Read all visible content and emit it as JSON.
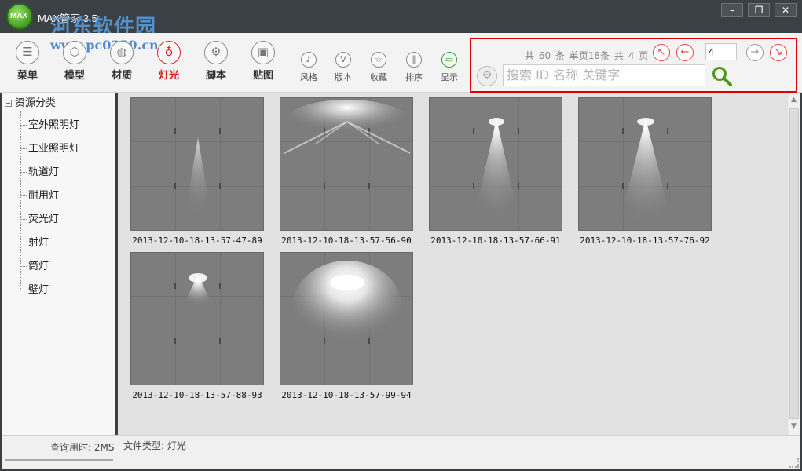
{
  "titlebar": {
    "app_title": "MAX管家 3.5",
    "logo_text": "MAX",
    "watermark": "河东软件园",
    "watermark_url": "www.pc0359.cn",
    "buttons": [
      "minimize",
      "restore",
      "close"
    ]
  },
  "toolbar": {
    "tools": [
      {
        "label": "菜单",
        "icon": "menu-icon"
      },
      {
        "label": "模型",
        "icon": "cube-icon"
      },
      {
        "label": "材质",
        "icon": "material-icon"
      },
      {
        "label": "灯光",
        "icon": "bulb-icon",
        "active": true
      },
      {
        "label": "脚本",
        "icon": "gear-icon"
      },
      {
        "label": "贴图",
        "icon": "image-icon"
      }
    ],
    "small_tools": [
      {
        "label": "风格",
        "icon": "music-note-icon"
      },
      {
        "label": "版本",
        "icon": "version-icon"
      },
      {
        "label": "收藏",
        "icon": "star-icon"
      },
      {
        "label": "排序",
        "icon": "sort-icon"
      },
      {
        "label": "显示",
        "icon": "display-icon"
      }
    ],
    "active_color": "#e02020"
  },
  "pagination": {
    "total_prefix": "共",
    "total": "60",
    "total_unit": "条",
    "per_page_text": "单页18条",
    "pages_prefix": "共",
    "pages": "4",
    "pages_unit": "页",
    "current_page": "4"
  },
  "search": {
    "placeholder": "搜索 ID 名称 关键字"
  },
  "sidebar": {
    "root_toggle": "⊟",
    "root": "资源分类",
    "items": [
      "室外照明灯",
      "工业照明灯",
      "轨道灯",
      "耐用灯",
      "荧光灯",
      "射灯",
      "筒灯",
      "壁灯"
    ]
  },
  "thumbnails": [
    {
      "caption": "2013-12-10-18-13-57-47-89"
    },
    {
      "caption": "2013-12-10-18-13-57-56-90"
    },
    {
      "caption": "2013-12-10-18-13-57-66-91"
    },
    {
      "caption": "2013-12-10-18-13-57-76-92"
    },
    {
      "caption": "2013-12-10-18-13-57-88-93"
    },
    {
      "caption": "2013-12-10-18-13-57-99-94"
    }
  ],
  "status": {
    "query_time": "查询用时: 2MS",
    "file_type": "文件类型: 灯光"
  }
}
